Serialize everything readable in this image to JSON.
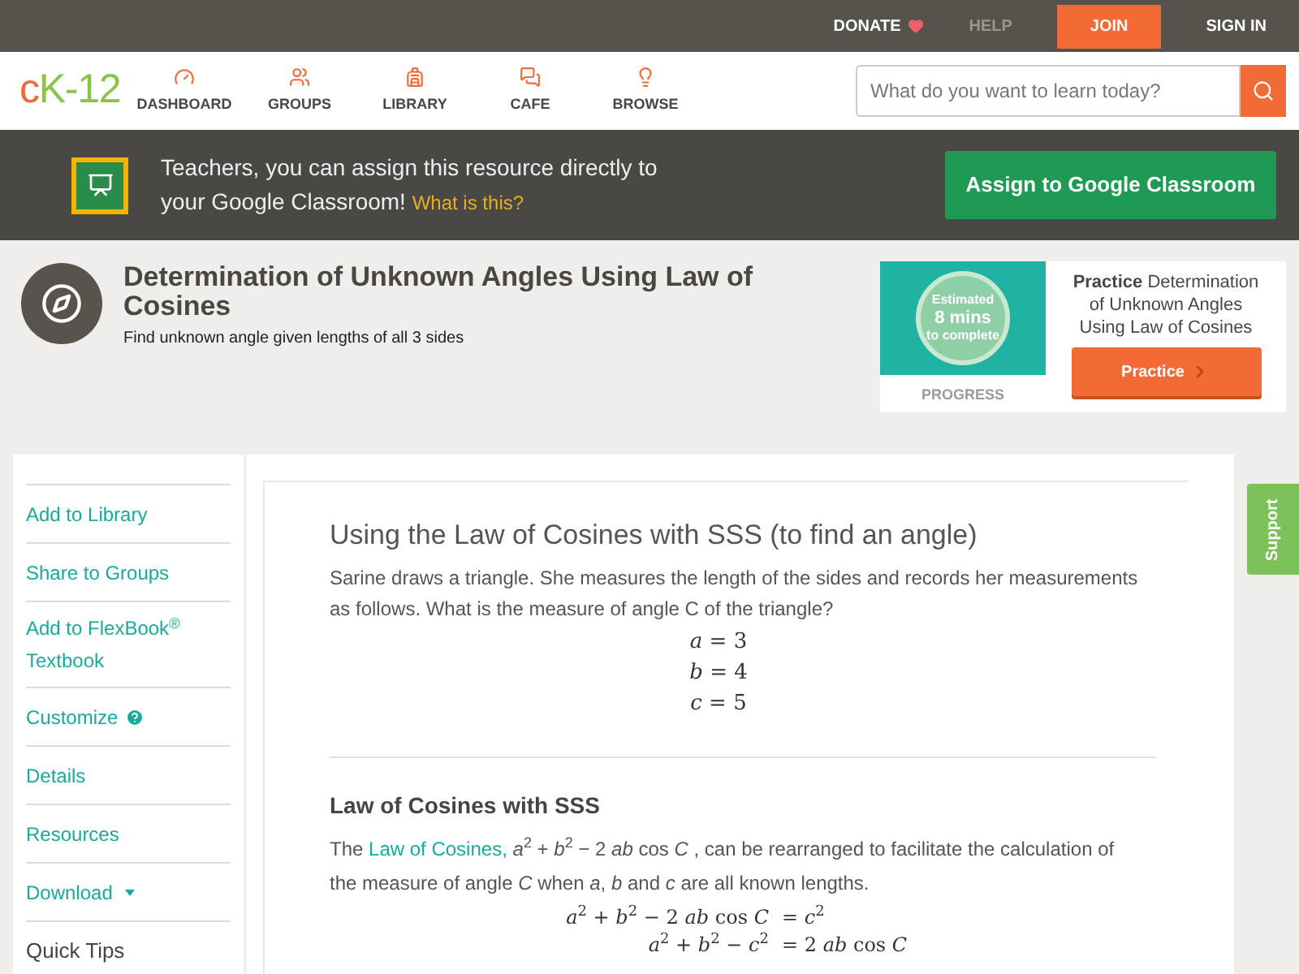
{
  "topbar": {
    "links": [
      {
        "label": "DONATE",
        "kind": "donate"
      },
      {
        "label": "HELP",
        "kind": "muted"
      },
      {
        "label": "JOIN",
        "kind": "primary"
      },
      {
        "label": "SIGN IN",
        "kind": "plain"
      }
    ]
  },
  "nav": {
    "logo": "cK-12",
    "items": [
      {
        "label": "DASHBOARD"
      },
      {
        "label": "GROUPS"
      },
      {
        "label": "LIBRARY"
      },
      {
        "label": "CAFE"
      },
      {
        "label": "BROWSE"
      }
    ],
    "search": {
      "placeholder": "What do you want to learn today?"
    }
  },
  "banner": {
    "text": "Teachers, you can assign this resource directly to your Google Classroom!",
    "link": "What is this?",
    "button": "Assign to Google Classroom"
  },
  "header": {
    "title": "Determination of Unknown Angles Using Law of Cosines",
    "subtitle": "Find unknown angle given lengths of all 3 sides"
  },
  "practice": {
    "estimate": [
      "Estimated",
      "8 mins",
      "to complete"
    ],
    "progress": "PROGRESS",
    "title_bold": "Practice",
    "title": "Determination of Unknown Angles Using Law of Cosines",
    "button": "Practice"
  },
  "sidebar": {
    "items": [
      {
        "label": "Add to Library",
        "kind": "link"
      },
      {
        "label": "Share to Groups",
        "kind": "link"
      },
      {
        "label": "Add to FlexBook$^{®}$ Textbook",
        "kind": "link"
      },
      {
        "label": "Customize",
        "kind": "help"
      },
      {
        "label": "Details",
        "kind": "link"
      },
      {
        "label": "Resources",
        "kind": "link"
      },
      {
        "label": "Download",
        "kind": "dropdown"
      },
      {
        "label": "Quick Tips",
        "kind": "heading"
      }
    ]
  },
  "content": {
    "title": "Using the Law of Cosines with SSS (to find an angle)",
    "intro": "Sarine draws a triangle. She measures the length of the sides and records her measurements as follows. What is the measure of angle C of the triangle?",
    "givens": [
      "*a* = 3",
      "*b* = 4",
      "*c* = 5"
    ],
    "section": "Law of Cosines with SSS",
    "para_before": "The",
    "para_link": "Law of Cosines,",
    "para_after": "*a*$^{2}$ + *b*$^{2}$ − 2 *ab* cos *C* , can be rearranged to facilitate the calculation of the measure of angle *C* when *a*, *b* and *c* are all known lengths.",
    "equations": [
      {
        "left": "*a*$^{2}$ + *b*$^{2}$ − 2 *ab* cos *C*",
        "right": "= *c*$^{2}$"
      },
      {
        "left": "*a*$^{2}$ + *b*$^{2}$ − *c*$^{2}$",
        "right": "= 2 *ab* cos *C*"
      }
    ]
  },
  "support": "Support"
}
